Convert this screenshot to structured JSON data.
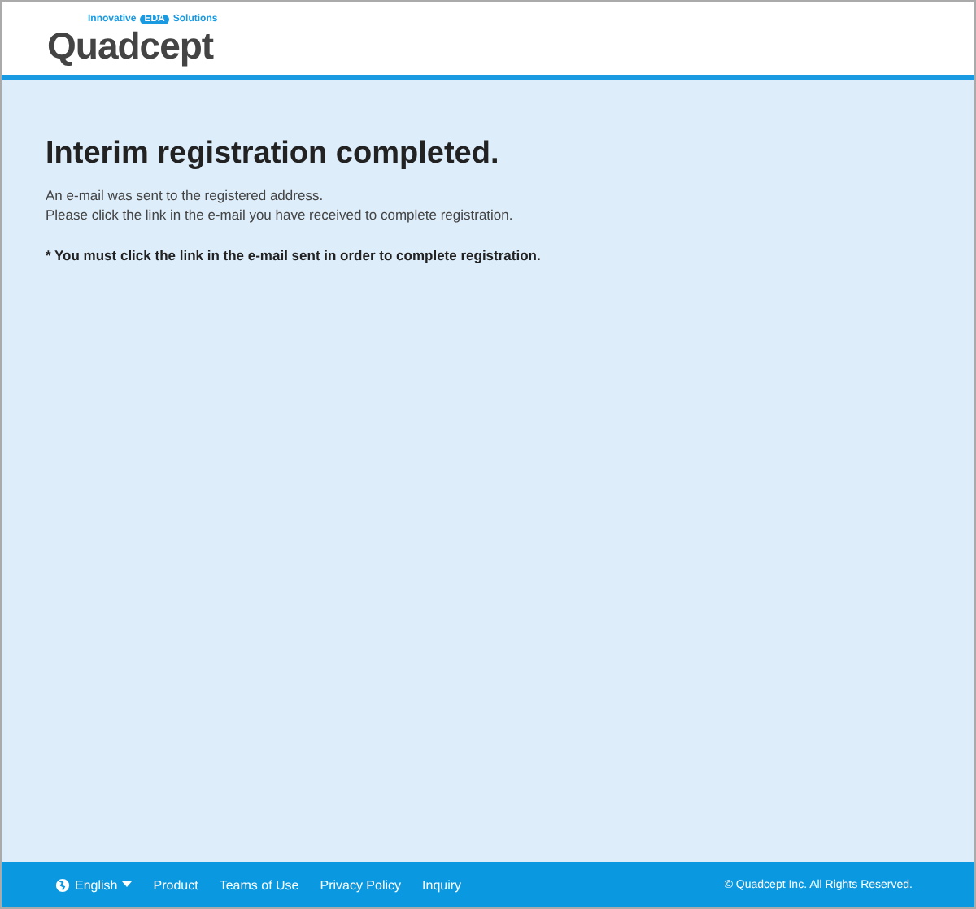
{
  "logo": {
    "tagline_left": "Innovative",
    "tagline_badge": "EDA",
    "tagline_right": "Solutions",
    "name": "Quadcept"
  },
  "main": {
    "title": "Interim registration completed.",
    "lines": [
      "An e-mail was sent to the registered address.",
      "Please click the link in the e-mail you have received to complete registration."
    ],
    "note": "* You must click the link in the e-mail sent in order to complete registration."
  },
  "footer": {
    "language": "English",
    "links": [
      "Product",
      "Teams of Use",
      "Privacy Policy",
      "Inquiry"
    ],
    "copyright": "© Quadcept Inc.  All Rights Reserved."
  }
}
